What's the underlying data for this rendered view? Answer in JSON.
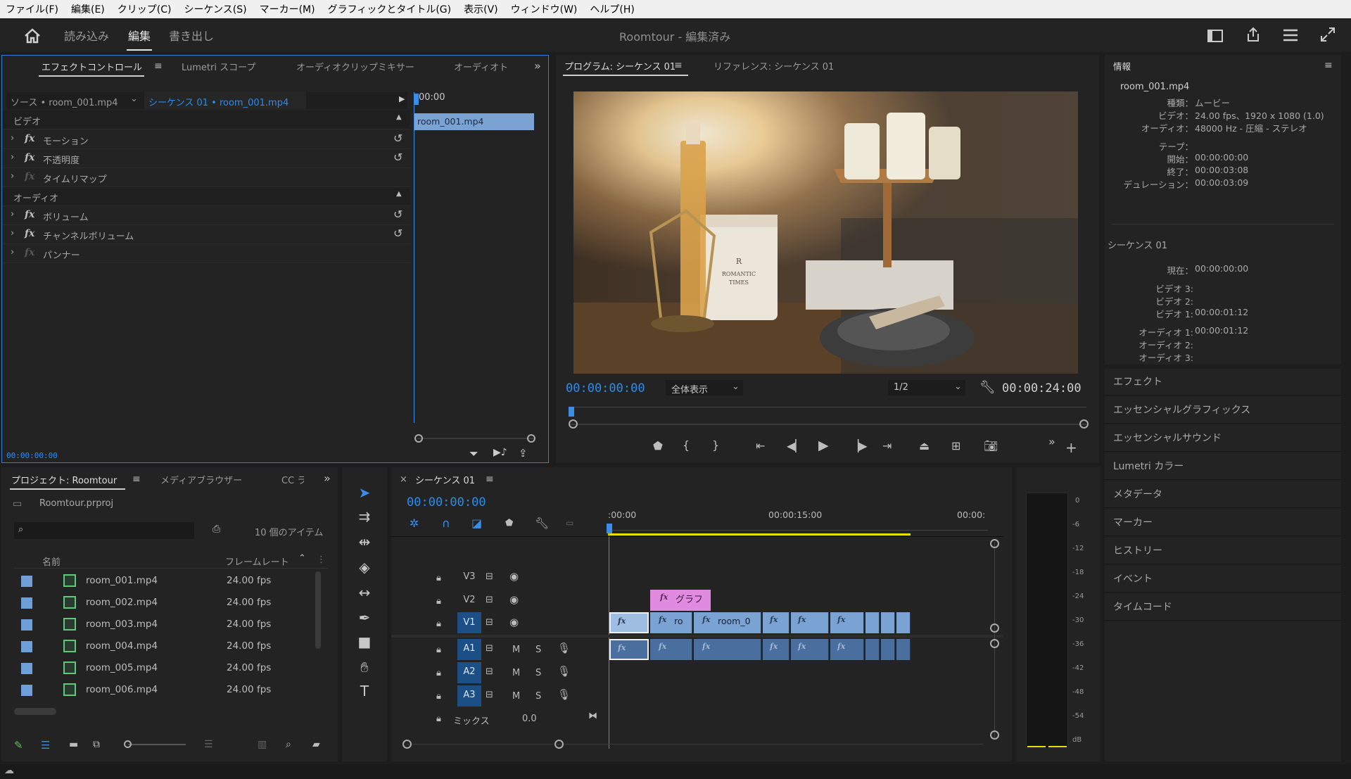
{
  "menu": [
    "ファイル(F)",
    "編集(E)",
    "クリップ(C)",
    "シーケンス(S)",
    "マーカー(M)",
    "グラフィックとタイトル(G)",
    "表示(V)",
    "ウィンドウ(W)",
    "ヘルプ(H)"
  ],
  "workspaces": {
    "import": "読み込み",
    "edit": "編集",
    "export": "書き出し"
  },
  "app_title": "Roomtour",
  "app_status": "- 編集済み",
  "effect_panel": {
    "tabs": [
      "エフェクトコントロール",
      "Lumetri スコープ",
      "オーディオクリップミキサー",
      "オーディオト"
    ],
    "source": "ソース • room_001.mp4",
    "sequence": "シーケンス 01 • room_001.mp4",
    "time": "00:00",
    "clip": "room_001.mp4",
    "video_header": "ビデオ",
    "audio_header": "オーディオ",
    "video_effects": [
      "モーション",
      "不透明度",
      "タイムリマップ"
    ],
    "audio_effects": [
      "ボリューム",
      "チャンネルボリューム",
      "パンナー"
    ],
    "timecode": "00:00:00:00"
  },
  "program": {
    "tab": "プログラム: シーケンス 01",
    "ref_tab": "リファレンス: シーケンス 01",
    "timecode": "00:00:00:00",
    "fit": "全体表示",
    "resolution": "1/2",
    "duration": "00:00:24:00",
    "label_r": "R",
    "label_romantic": "ROMANTIC",
    "label_times": "TIMES"
  },
  "info": {
    "tab": "情報",
    "file": "room_001.mp4",
    "rows": [
      [
        "種類：",
        "ムービー"
      ],
      [
        "ビデオ：",
        "24.00 fps、1920 x 1080 (1.0)"
      ],
      [
        "オーディオ：",
        "48000 Hz - 圧縮 - ステレオ"
      ],
      [
        "テープ：",
        ""
      ],
      [
        "開始：",
        "00:00:00:00"
      ],
      [
        "終了：",
        "00:00:03:08"
      ],
      [
        "デュレーション：",
        "00:00:03:09"
      ]
    ],
    "sequence": "シーケンス 01",
    "seq_rows": [
      [
        "現在：",
        "00:00:00:00"
      ],
      [
        "ビデオ 3:",
        ""
      ],
      [
        "ビデオ 2:",
        ""
      ],
      [
        "ビデオ 1:",
        "00:00:01:12"
      ],
      [
        "オーディオ 1:",
        "00:00:01:12"
      ],
      [
        "オーディオ 2:",
        ""
      ],
      [
        "オーディオ 3:",
        ""
      ]
    ]
  },
  "right_panels": [
    "エフェクト",
    "エッセンシャルグラフィックス",
    "エッセンシャルサウンド",
    "Lumetri カラー",
    "メタデータ",
    "マーカー",
    "ヒストリー",
    "イベント",
    "タイムコード"
  ],
  "project": {
    "tabs": [
      "プロジェクト: Roomtour",
      "メディアブラウザー",
      "CC ラ"
    ],
    "file": "Roomtour.prproj",
    "count": "10 個のアイテム",
    "col_name": "名前",
    "col_fps": "フレームレート",
    "items": [
      {
        "name": "room_001.mp4",
        "fps": "24.00 fps"
      },
      {
        "name": "room_002.mp4",
        "fps": "24.00 fps"
      },
      {
        "name": "room_003.mp4",
        "fps": "24.00 fps"
      },
      {
        "name": "room_004.mp4",
        "fps": "24.00 fps"
      },
      {
        "name": "room_005.mp4",
        "fps": "24.00 fps"
      },
      {
        "name": "room_006.mp4",
        "fps": "24.00 fps"
      }
    ]
  },
  "timeline": {
    "tab": "シーケンス 01",
    "timecode": "00:00:00:00",
    "ruler": [
      ":00:00",
      "00:00:15:00",
      "00:00:"
    ],
    "tracks_video": [
      "V3",
      "V2",
      "V1"
    ],
    "tracks_audio": [
      "A1",
      "A2",
      "A3"
    ],
    "m": "M",
    "s": "S",
    "mix_label": "ミックス",
    "mix_value": "0.0",
    "title_clip": "グラフ",
    "clip_ro": "ro",
    "clip_room": "room_0"
  },
  "vu": {
    "labels": [
      "0",
      "-6",
      "-12",
      "-18",
      "-24",
      "-30",
      "-36",
      "-42",
      "-48",
      "-54",
      "dB"
    ]
  }
}
